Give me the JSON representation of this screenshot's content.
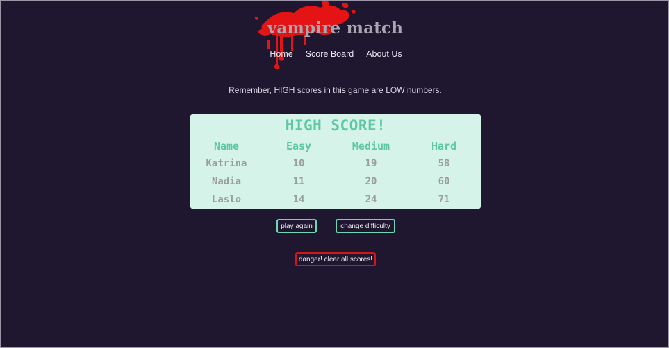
{
  "header": {
    "site_title": "vampire match",
    "splatter_color": "#e41414",
    "nav": [
      "Home",
      "Score Board",
      "About Us"
    ]
  },
  "reminder": "Remember, HIGH scores in this game are LOW numbers.",
  "scoreboard": {
    "title": "HIGH SCORE!",
    "columns": [
      "Name",
      "Easy",
      "Medium",
      "Hard"
    ],
    "rows": [
      [
        "Katrina",
        "10",
        "19",
        "58"
      ],
      [
        "Nadia",
        "11",
        "20",
        "60"
      ],
      [
        "Laslo",
        "14",
        "24",
        "71"
      ]
    ]
  },
  "buttons": {
    "play_again": "play again",
    "change_difficulty": "change difficulty",
    "clear_scores": "danger! clear all scores!"
  },
  "colors": {
    "background": "#1f1630",
    "card": "#d6f3e9",
    "accent": "#5dc8a2",
    "button_border": "#6fd6b2",
    "danger": "#d61616"
  }
}
